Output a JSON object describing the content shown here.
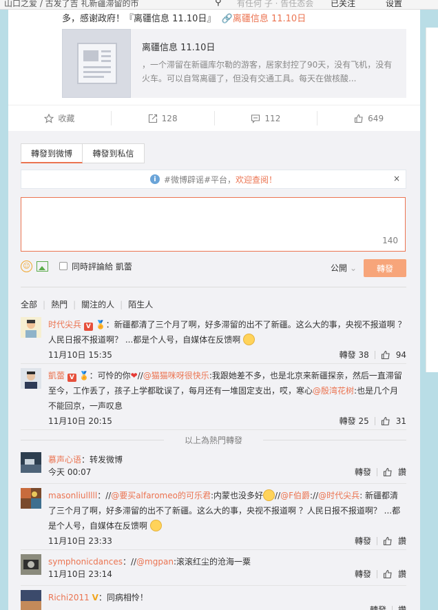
{
  "browser": {
    "address_fragment": "山口之爱 / 古发了吉 礼新疆滞留的市",
    "middle_fragment": "有任何 子 · 告任态会",
    "right_item_1": "已关注",
    "right_item_2": "设置"
  },
  "original_post": {
    "tail_text": "多，感谢政府！『",
    "tail_link": "离疆信息 11.10日",
    "tail_close": "』",
    "share_link": "离疆信息 11.10日",
    "card": {
      "title": "离疆信息 11.10日",
      "description": "，一个滞留在新疆库尔勒的游客，居家封控了90天，没有飞机，没有火车。可以自驾离疆了，但没有交通工具。每天在做核酸..."
    },
    "actions": {
      "favorite_label": "收藏",
      "repost_count": "128",
      "comment_count": "112",
      "like_count": "649"
    }
  },
  "repost_panel": {
    "tabs": [
      "轉發到微博",
      "轉發到私信"
    ],
    "notice_prefix": "#微博辟谣#平台，",
    "notice_link": "欢迎查阅！",
    "notice_close": "×",
    "textarea_value": "",
    "char_remaining": "140",
    "also_comment_label": "同時評論給 凱蕾",
    "visibility_label": "公開",
    "send_label": "轉發",
    "filters": [
      "全部",
      "熱門",
      "關注的人",
      "陌生人"
    ],
    "hot_divider": "以上為熱門轉發"
  },
  "reposts": [
    {
      "user": "时代尖兵",
      "text": "：新疆都清了三个月了啊，好多滞留的出不了新疆。这么大的事，央视不报道啊 ？人民日报不报道啊？ ...都是个人号，自媒体在反馈啊",
      "time": "11月10日 15:35",
      "repost_label": "轉發 38",
      "likes": "94"
    },
    {
      "user": "凱蕾",
      "text_a": "：可怜的你",
      "mention_1": "@猫猫咪呀很快乐",
      "text_b": ":我跟她差不多，也是北京来新疆探亲，然后一直滞留至今，工作丢了，孩子上学都耽误了，每月还有一堆固定支出，哎，寒心",
      "mention_2": "@殷湾花树",
      "text_c": ":也是几个月不能回京，一声叹息",
      "time": "11月10日 20:15",
      "repost_label": "轉發 25",
      "likes": "31"
    },
    {
      "user": "慕声心语",
      "text": "：转发微博",
      "time": "今天 00:07",
      "repost_label": "轉發",
      "likes": "讚"
    },
    {
      "user": "masonliulllll",
      "text_a": "：//",
      "mention_1": "@要买alfaromeo的可乐君",
      "text_b": ":内蒙也没多好",
      "text_c": "//",
      "mention_2": "@F伯爵",
      "text_d": ":",
      "text_e": "//",
      "mention_3": "@时代尖兵",
      "text_f": ": 新疆都清了三个月了啊，好多滞留的出不了新疆。这么大的事，央视不报道啊 ？人民日报不报道啊？ ...都是个人号，自媒体在反馈啊",
      "time": "11月10日 23:33",
      "repost_label": "轉發",
      "likes": "讚"
    },
    {
      "user": "symphonicdances",
      "text_a": "：//",
      "mention_1": "@mgpan",
      "text_b": ":滚滚红尘的沧海一粟",
      "time": "11月10日 23:14",
      "repost_label": "轉發",
      "likes": "讚"
    },
    {
      "user": "Richi2011",
      "text": "：同病相怜！",
      "time": "",
      "repost_label": "轉發",
      "likes": "讚"
    }
  ],
  "colors": {
    "accent": "#eb7350",
    "page_bg": "#b9dde6",
    "panel_bg": "#f2f2f5"
  }
}
